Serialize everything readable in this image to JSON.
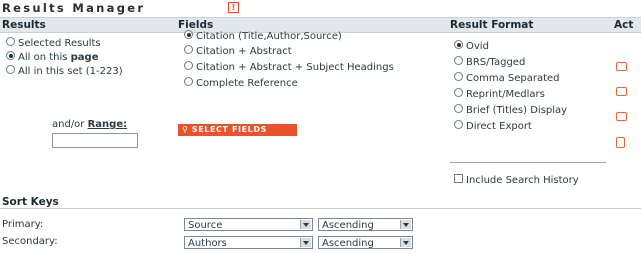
{
  "title": "Results Manager",
  "help_icon": "!",
  "headers": {
    "results": "Results",
    "fields": "Fields",
    "format": "Result Format",
    "actions": "Act"
  },
  "results": {
    "opt1": "Selected Results",
    "opt2_prefix": "All on this ",
    "opt2_bold": "page",
    "opt3": "All in this set (1-223)",
    "range_prefix": "and/or ",
    "range_label": "Range:"
  },
  "fields": {
    "opt1": "Citation (Title,Author,Source)",
    "opt2": "Citation + Abstract",
    "opt3": "Citation + Abstract + Subject Headings",
    "opt4": "Complete Reference",
    "select_button": "SELECT FIELDS"
  },
  "format": {
    "opt1": "Ovid",
    "opt2": "BRS/Tagged",
    "opt3": "Comma Separated",
    "opt4": "Reprint/Medlars",
    "opt5": "Brief (Titles) Display",
    "opt6": "Direct Export",
    "history": "Include Search History"
  },
  "sort": {
    "title": "Sort Keys",
    "primary_label": "Primary:",
    "secondary_label": "Secondary:",
    "primary_field": "Source",
    "primary_order": "Ascending",
    "secondary_field": "Authors",
    "secondary_order": "Ascending"
  },
  "colors": {
    "accent": "#e8532a",
    "header_bg": "#e2e7ec"
  }
}
